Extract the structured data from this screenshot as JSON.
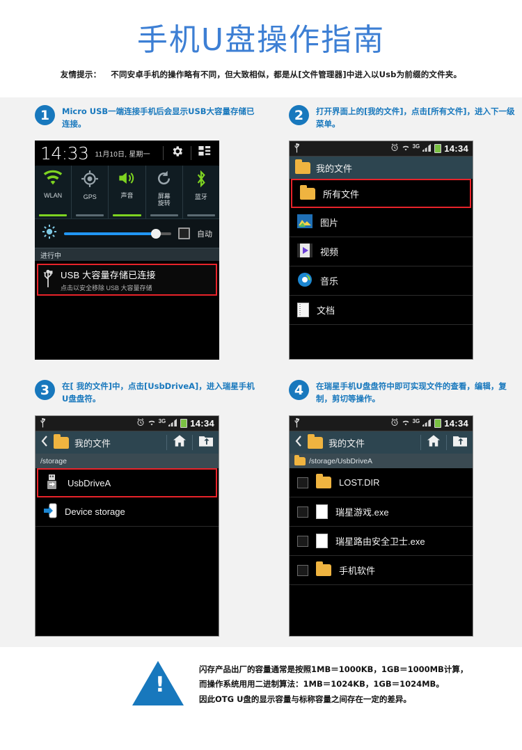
{
  "header": {
    "title": "手机U盘操作指南",
    "tip_lead": "友情提示：",
    "tip_text": "不同安卓手机的操作略有不同，但大致相似，都是从[文件管理器]中进入以Usb为前缀的文件夹。"
  },
  "colors": {
    "accent": "#1878bd",
    "title_blue": "#3d7fd4",
    "highlight_red": "#e8232a",
    "toggle_on_green": "#7ed321",
    "folder_yellow": "#efb440",
    "panel_bg": "#f2f2f2"
  },
  "steps": [
    {
      "number": "1",
      "text": "Micro USB一端连接手机后会显示USB大容量存储已连接。"
    },
    {
      "number": "2",
      "text": "打开界面上的[我的文件]，点击[所有文件]，进入下一级菜单。"
    },
    {
      "number": "3",
      "text": "在[ 我的文件]中，点击[UsbDriveA]，进入瑞星手机U盘盘符。"
    },
    {
      "number": "4",
      "text": "在瑞星手机U盘盘符中即可实现文件的查看，编辑，复制，剪切等操作。"
    }
  ],
  "screen1": {
    "clock": "14:33",
    "date": "11月10日, 星期一",
    "gear_icon": "gear-icon",
    "grid_icon": "grid-icon",
    "toggles": [
      {
        "label": "WLAN",
        "icon": "wifi-icon",
        "state": "on"
      },
      {
        "label": "GPS",
        "icon": "gps-icon",
        "state": "off"
      },
      {
        "label": "声音",
        "icon": "volume-icon",
        "state": "on"
      },
      {
        "label": "屏幕\n旋转",
        "label_l1": "屏幕",
        "label_l2": "旋转",
        "icon": "rotate-icon",
        "state": "off"
      },
      {
        "label": "蓝牙",
        "icon": "bluetooth-icon",
        "state": "off"
      }
    ],
    "brightness": {
      "icon": "brightness-icon",
      "value": 84,
      "auto_label": "自动",
      "auto_checked": false
    },
    "section_header": "进行中",
    "notification": {
      "icon": "usb-icon",
      "title": "USB 大容量存储已连接",
      "subtitle": "点击以安全移除 USB 大容量存储"
    }
  },
  "screen2": {
    "statusbar": {
      "usb_icon": "usb-icon",
      "alarm_icon": "alarm-icon",
      "wifi_icon": "wifi-icon",
      "network": "3G",
      "signal_icon": "signal-icon",
      "battery_icon": "battery-icon",
      "clock": "14:34"
    },
    "title": "我的文件",
    "items": [
      {
        "label": "所有文件",
        "icon": "folder-icon",
        "highlighted": true
      },
      {
        "label": "图片",
        "icon": "picture-icon",
        "highlighted": false
      },
      {
        "label": "视频",
        "icon": "video-icon",
        "highlighted": false
      },
      {
        "label": "音乐",
        "icon": "music-icon",
        "highlighted": false
      },
      {
        "label": "文档",
        "icon": "document-icon",
        "highlighted": false
      }
    ]
  },
  "screen3": {
    "statusbar": {
      "network": "3G",
      "clock": "14:34"
    },
    "back_icon": "back-chevron-icon",
    "title": "我的文件",
    "home_icon": "home-icon",
    "up_icon": "up-folder-icon",
    "path": "/storage",
    "items": [
      {
        "label": "UsbDriveA",
        "icon": "usb-drive-icon",
        "highlighted": true
      },
      {
        "label": "Device storage",
        "icon": "device-storage-icon",
        "highlighted": false
      }
    ]
  },
  "screen4": {
    "statusbar": {
      "network": "3G",
      "clock": "14:34"
    },
    "back_icon": "back-chevron-icon",
    "title": "我的文件",
    "home_icon": "home-icon",
    "up_icon": "up-folder-icon",
    "path": "/storage/UsbDriveA",
    "items": [
      {
        "label": "LOST.DIR",
        "icon": "folder-icon",
        "checked": false
      },
      {
        "label": "瑞星游戏.exe",
        "icon": "file-icon",
        "checked": false
      },
      {
        "label": "瑞星路由安全卫士.exe",
        "icon": "file-icon",
        "checked": false
      },
      {
        "label": "手机软件",
        "icon": "folder-icon",
        "checked": false
      }
    ]
  },
  "warning": {
    "icon": "warning-triangle-icon",
    "line1": "闪存产品出厂的容量通常是按照1MB＝1000KB，1GB＝1000MB计算，",
    "line2": "而操作系统用用二进制算法：1MB＝1024KB，1GB＝1024MB。",
    "line3": "因此OTG U盘的显示容量与标称容量之间存在一定的差异。"
  }
}
